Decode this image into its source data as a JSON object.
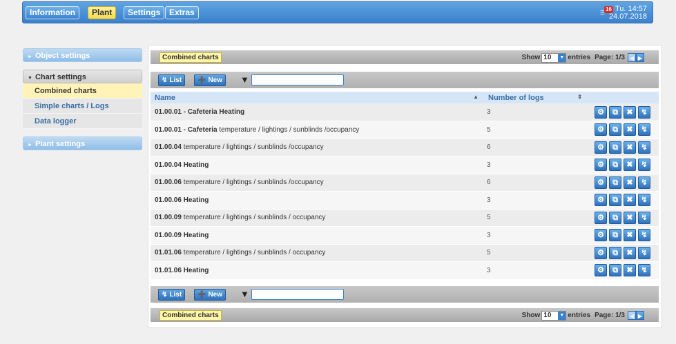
{
  "nav": {
    "items": [
      "Information",
      "Plant",
      "Settings",
      "Extras"
    ],
    "alarm_count": "16",
    "clock_time": "Tu. 14:57",
    "clock_date": "24.07.2018"
  },
  "sidebar": {
    "object_settings": "Object settings",
    "chart_settings": "Chart settings",
    "chart_items": [
      "Combined charts",
      "Simple charts / Logs",
      "Data logger"
    ],
    "plant_settings": "Plant settings"
  },
  "main": {
    "breadcrumb": "Combined charts",
    "show_label": "Show",
    "entries_value": "10",
    "entries_label": "entries",
    "page_label": "Page: 1/3",
    "list_button": "List",
    "new_button": "New",
    "filter_placeholder": "",
    "columns": {
      "name": "Name",
      "logs": "Number of logs"
    },
    "rows": [
      {
        "bold": "01.00.01 - Cafeteria Heating",
        "rest": "",
        "logs": "3"
      },
      {
        "bold": "01.00.01 - Cafeteria",
        "rest": " temperature / lightings / sunblinds /occupancy",
        "logs": "5"
      },
      {
        "bold": "01.00.04",
        "rest": " temperature / lightings / sunblinds /occupancy",
        "logs": "6"
      },
      {
        "bold": "01.00.04 Heating",
        "rest": "",
        "logs": "3"
      },
      {
        "bold": "01.00.06",
        "rest": " temperature / lightings / sunblinds /occupancy",
        "logs": "6"
      },
      {
        "bold": "01.00.06 Heating",
        "rest": "",
        "logs": "3"
      },
      {
        "bold": "01.00.09",
        "rest": " temperature / lightings / sunblinds / occupancy",
        "logs": "5"
      },
      {
        "bold": "01.00.09 Heating",
        "rest": "",
        "logs": "3"
      },
      {
        "bold": "01.01.06",
        "rest": " temperature / lightings / sunblinds / occupancy",
        "logs": "5"
      },
      {
        "bold": "01.01.06 Heating",
        "rest": "",
        "logs": "3"
      }
    ]
  },
  "colors": {
    "accent": "#3a80cc",
    "active_tab": "#f5d94e",
    "active_item": "#fff3b8"
  }
}
